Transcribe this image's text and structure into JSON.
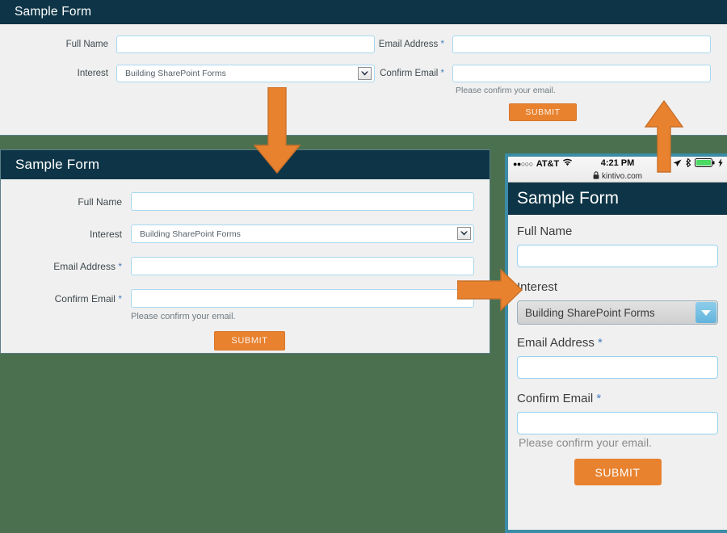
{
  "background_color": "#4a7050",
  "accent_color": "#e8822f",
  "header_color": "#0e3547",
  "required_marker": "*",
  "desktop_form": {
    "title": "Sample Form",
    "fields": {
      "full_name_label": "Full Name",
      "full_name_value": "",
      "interest_label": "Interest",
      "interest_value": "Building SharePoint Forms",
      "email_label": "Email Address",
      "email_value": "",
      "confirm_label": "Confirm Email",
      "confirm_value": "",
      "confirm_hint": "Please confirm your email."
    },
    "submit_label": "SUBMIT"
  },
  "tablet_form": {
    "title": "Sample Form",
    "fields": {
      "full_name_label": "Full Name",
      "full_name_value": "",
      "interest_label": "Interest",
      "interest_value": "Building SharePoint Forms",
      "email_label": "Email Address",
      "email_value": "",
      "confirm_label": "Confirm Email",
      "confirm_value": "",
      "confirm_hint": "Please confirm your email."
    },
    "submit_label": "SUBMIT"
  },
  "phone": {
    "status_bar": {
      "signal_dots": "●●○○○",
      "carrier": "AT&T",
      "wifi_icon": "wifi-icon",
      "time": "4:21 PM",
      "location_icon": "location-arrow-icon",
      "bluetooth_icon": "bluetooth-icon",
      "battery_icon": "battery-icon",
      "charging_icon": "charging-bolt-icon",
      "battery_color": "#4cd964"
    },
    "url_bar": {
      "lock_icon": "lock-icon",
      "url": "kintivo.com"
    },
    "title": "Sample Form",
    "fields": {
      "full_name_label": "Full Name",
      "full_name_value": "",
      "interest_label": "Interest",
      "interest_value": "Building SharePoint Forms",
      "email_label": "Email Address",
      "email_value": "",
      "confirm_label": "Confirm Email",
      "confirm_value": "",
      "confirm_hint": "Please confirm your email."
    },
    "submit_label": "SUBMIT",
    "frame_color": "#3b8ca6"
  },
  "annotations": {
    "arrow_down": "arrow-down-icon",
    "arrow_up": "arrow-up-icon",
    "arrow_right": "arrow-right-icon"
  }
}
